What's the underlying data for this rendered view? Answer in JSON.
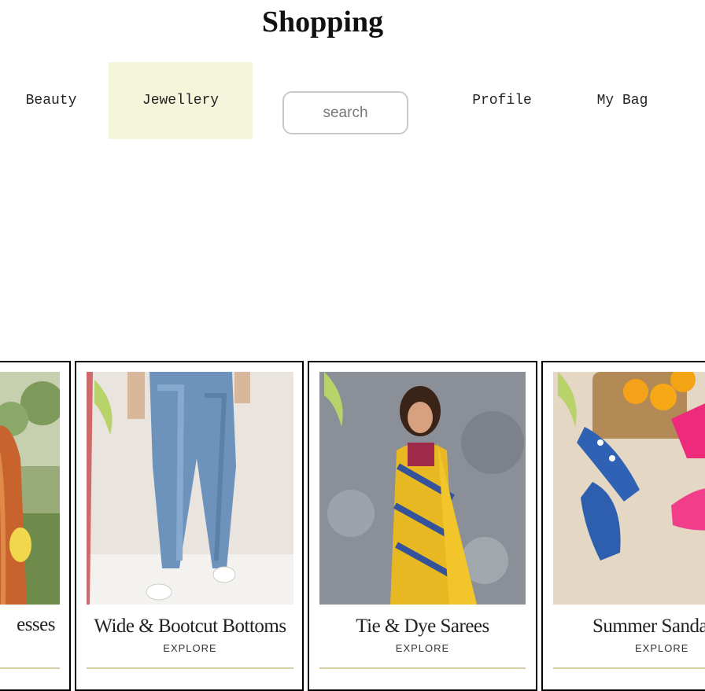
{
  "header": {
    "title": "Shopping"
  },
  "nav": {
    "beauty": "Beauty",
    "jewellery": "Jewellery",
    "search_placeholder": "search",
    "profile": "Profile",
    "bag": "My Bag"
  },
  "cards": [
    {
      "title": "esses",
      "cta": ""
    },
    {
      "title": "Wide & Bootcut Bottoms",
      "cta": "EXPLORE"
    },
    {
      "title": "Tie & Dye Sarees",
      "cta": "EXPLORE"
    },
    {
      "title": "Summer Sanda",
      "cta": "EXPLORE"
    }
  ],
  "colors": {
    "active_tab_bg": "#f5f5dc",
    "card_border": "#000000"
  }
}
